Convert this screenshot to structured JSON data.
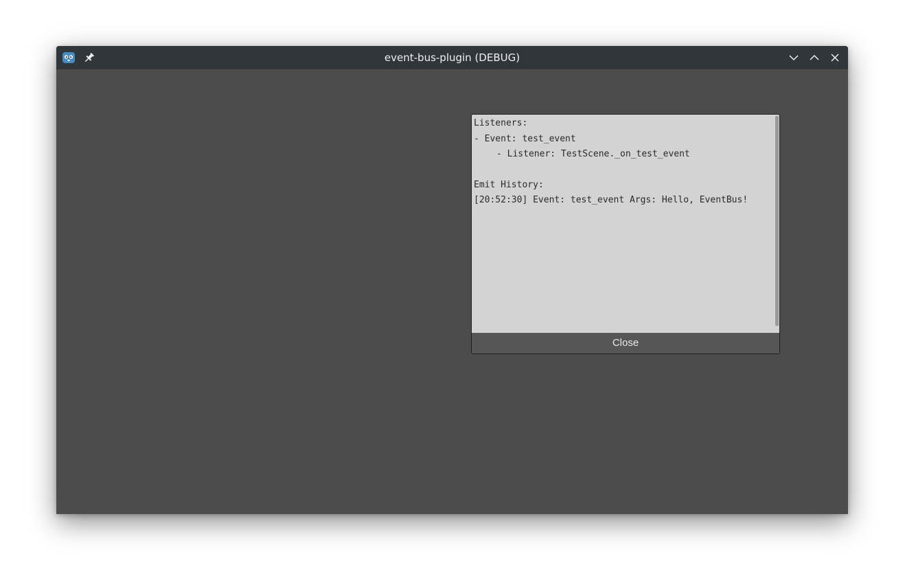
{
  "window": {
    "title": "event-bus-plugin (DEBUG)"
  },
  "titlebar": {
    "icons": [
      "godot-app-icon",
      "pin-icon"
    ],
    "buttons": [
      "minimize",
      "maximize",
      "close"
    ]
  },
  "debug_panel": {
    "lines": {
      "listeners_header": "Listeners:",
      "event_line": "- Event: test_event",
      "listener_line": "- Listener: TestScene._on_test_event",
      "emit_header": "Emit History:",
      "emit_entry": "[20:52:30] Event: test_event Args: Hello, EventBus!"
    },
    "close_label": "Close"
  },
  "colors": {
    "titlebar": "#31363b",
    "background": "#4c4c4c",
    "panel": "#d3d3d3",
    "button": "#565656"
  }
}
